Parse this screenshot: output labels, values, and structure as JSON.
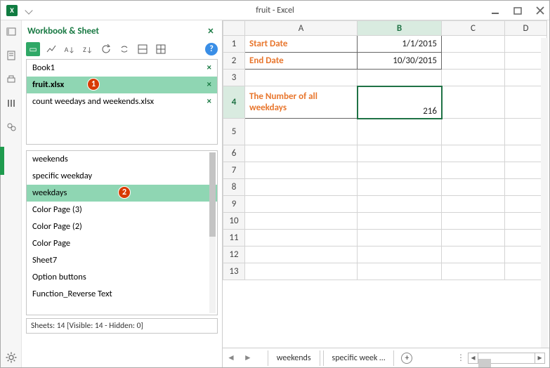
{
  "titlebar": {
    "title": "fruit - Excel",
    "app_icon": "X"
  },
  "pane": {
    "title": "Workbook & Sheet",
    "toolbar_icons": [
      "view",
      "chart",
      "sort-az",
      "sort-za",
      "refresh",
      "sync",
      "grid1",
      "grid2"
    ],
    "workbooks": [
      {
        "name": "Book1",
        "active": false
      },
      {
        "name": "fruit.xlsx",
        "active": true
      },
      {
        "name": "count weedays and weekends.xlsx",
        "active": false
      }
    ],
    "sheets": [
      "weekends",
      "specific weekday",
      "weekdays",
      "Color Page (3)",
      "Color Page (2)",
      "Color Page",
      "Sheet7",
      "Option buttons",
      "Function_Reverse Text"
    ],
    "active_sheet_index": 2,
    "status": "Sheets: 14  [Visible: 14 - Hidden: 0]",
    "badge1": "1",
    "badge2": "2"
  },
  "sheet": {
    "cols": [
      "A",
      "B",
      "C",
      "D"
    ],
    "rows": [
      "1",
      "2",
      "3",
      "4",
      "5",
      "6",
      "7",
      "8",
      "9",
      "10",
      "11",
      "12",
      "13"
    ],
    "a1": "Start Date",
    "b1": "1/1/2015",
    "a2": "End Date",
    "b2": "10/30/2015",
    "a4": "The Number of all weekdays",
    "b4": "216",
    "tabs": [
      "weekends",
      "specific week …"
    ]
  },
  "chart_data": null
}
